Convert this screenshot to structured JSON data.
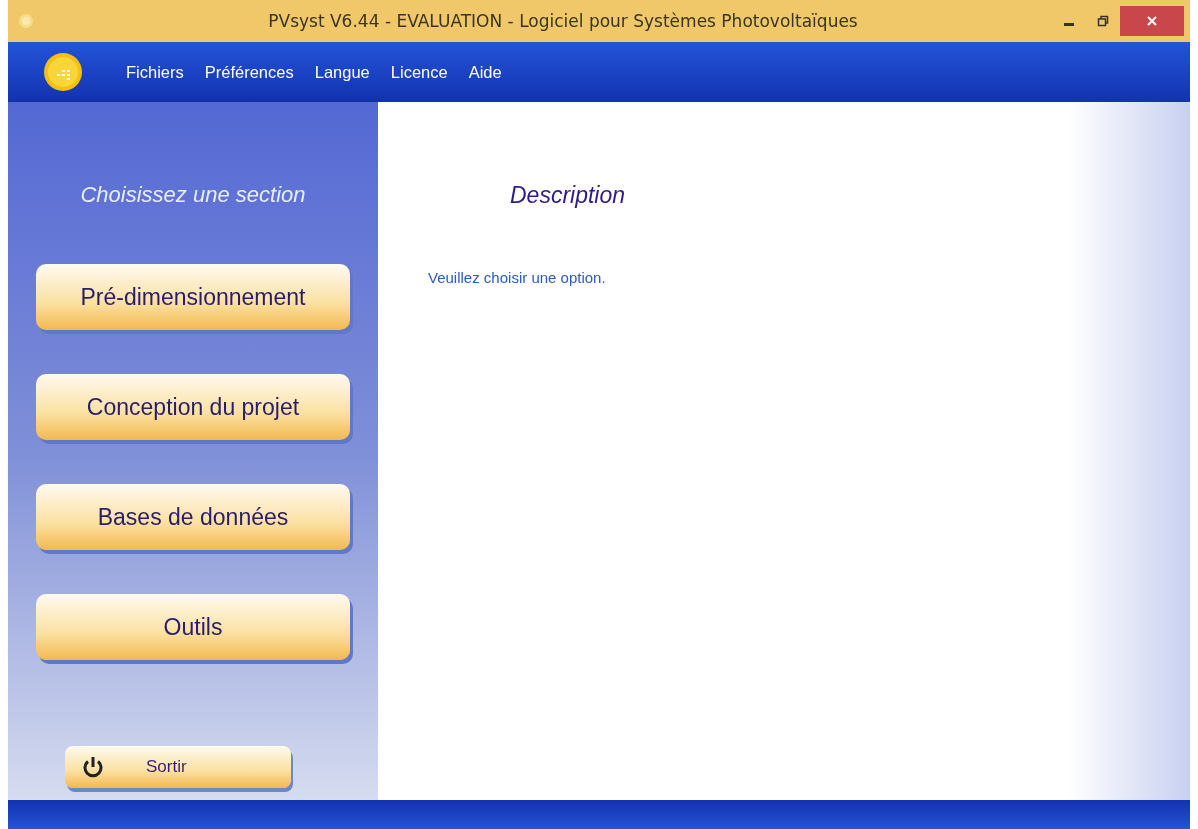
{
  "window": {
    "title": "PVsyst V6.44 - EVALUATION - Logiciel pour Systèmes Photovoltaïques"
  },
  "menu": [
    "Fichiers",
    "Préférences",
    "Langue",
    "Licence",
    "Aide"
  ],
  "sidebar": {
    "heading": "Choisissez une section",
    "items": [
      {
        "label": "Pré-dimensionnement"
      },
      {
        "label": "Conception du projet"
      },
      {
        "label": "Bases de données"
      },
      {
        "label": "Outils"
      }
    ],
    "exit_button": "Sortir"
  },
  "description": {
    "heading": "Description",
    "text": "Veuillez choisir une option."
  }
}
